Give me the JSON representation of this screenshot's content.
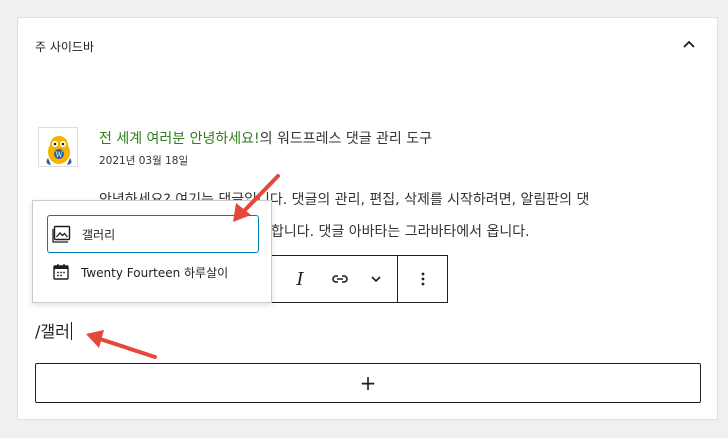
{
  "sidebar_panel": {
    "title": "주 사이드바",
    "collapse_icon": "chevron-up-icon"
  },
  "comment": {
    "link_text": "전 세계 여러분 안녕하세요!",
    "title_rest": "의 워드프레스 댓글 관리 도구",
    "date": "2021년 03월 18일",
    "body_line1_visible": "안녕하세요? 여기는 댓글입니다. 댓글의 관리, 편집, 삭제를 시작하려면, 알림판의 댓",
    "body_line2_visible": "합니다. 댓글 아바타는 그라바타에서 옵니다."
  },
  "block_toolbar": {
    "italic_label": "I",
    "link_icon": "link-icon",
    "more_icon": "chevron-down-icon",
    "options_icon": "more-vertical-icon"
  },
  "inserter_popup": {
    "options": [
      {
        "label": "갤러리",
        "icon": "gallery-icon",
        "selected": true
      },
      {
        "label": "Twenty Fourteen 하루살이",
        "icon": "calendar-icon",
        "selected": false
      }
    ]
  },
  "editor": {
    "slash_text": "/갤러"
  },
  "add_block": {
    "label": "+"
  },
  "colors": {
    "accent": "#007cba",
    "link": "#2e7d1a",
    "annotation_arrow": "#e5483a"
  }
}
